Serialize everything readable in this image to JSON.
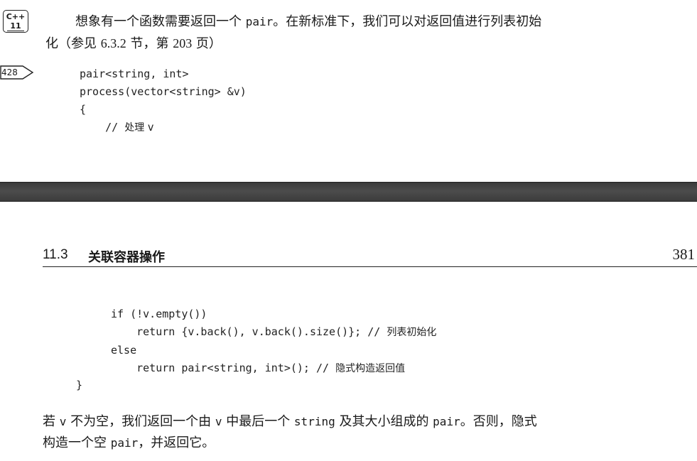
{
  "top_page": {
    "badge": {
      "line1": "C++",
      "line2": "11"
    },
    "margin_ref": "428",
    "para_1": {
      "before": "想象有一个函数需要返回一个 ",
      "code": "pair",
      "after": "。在新标准下，我们可以对返回值进行列表初始"
    },
    "para_2": {
      "before": "化（参见 ",
      "section": "6.3.2",
      "middle": " 节，第 ",
      "page": "203",
      "after": " 页）"
    },
    "code_lines": [
      "pair<string, int>",
      "process(vector<string> &v)",
      "{",
      "    "
    ],
    "code_comment_prefix": "// ",
    "code_comment_text": "处理 ",
    "code_comment_var": "v"
  },
  "bottom_page": {
    "chapter_number": "11.3",
    "chapter_title": "关联容器操作",
    "page_number": "381",
    "code": {
      "line_1": "if (!v.empty())",
      "line_2_code": "return {v.back(), v.back().size()}; // ",
      "line_2_comment": "列表初始化",
      "line_3": "else",
      "line_4_code": "return pair<string, int>(); // ",
      "line_4_comment": "隐式构造返回值",
      "line_5": "}"
    },
    "para_1": {
      "p1": "若 ",
      "v1": "v",
      "p2": " 不为空，我们返回一个由 ",
      "v2": "v",
      "p3": " 中最后一个 ",
      "c1": "string",
      "p4": " 及其大小组成的 ",
      "c2": "pair",
      "p5": "。否则，隐式"
    },
    "para_2": {
      "p1": "构造一个空 ",
      "c1": "pair",
      "p2": "，并返回它。"
    }
  }
}
